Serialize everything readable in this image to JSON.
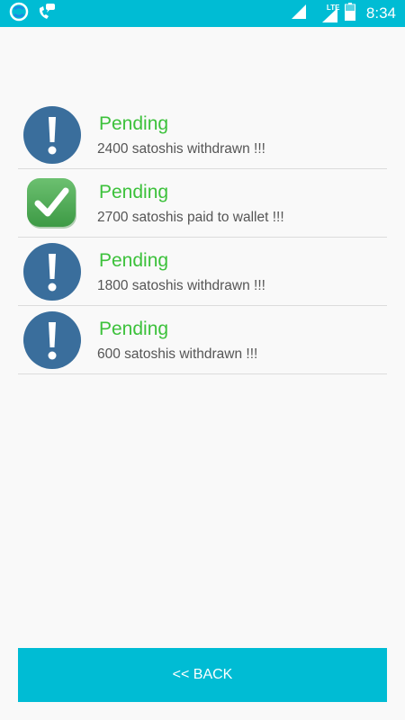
{
  "status_bar": {
    "time": "8:34",
    "network_label": "LTE",
    "icons": [
      "sync-icon",
      "phone-chat-icon",
      "wifi-signal-icon",
      "lte-signal-icon",
      "battery-icon"
    ],
    "color": "#00bcd4"
  },
  "transactions": [
    {
      "status": "Pending",
      "description": "2400 satoshis withdrawn !!!",
      "icon": "exclamation-icon"
    },
    {
      "status": "Pending",
      "description": "2700 satoshis paid to wallet !!!",
      "icon": "checkmark-icon"
    },
    {
      "status": "Pending",
      "description": "1800 satoshis withdrawn !!!",
      "icon": "exclamation-icon"
    },
    {
      "status": "Pending",
      "description": "600 satoshis withdrawn !!!",
      "icon": "exclamation-icon"
    }
  ],
  "back_button": {
    "label": "<< BACK"
  },
  "colors": {
    "accent": "#00bcd4",
    "pending_text": "#3cc13b",
    "exclamation_circle": "#3a6e9c",
    "check_badge": "#4caf50"
  }
}
